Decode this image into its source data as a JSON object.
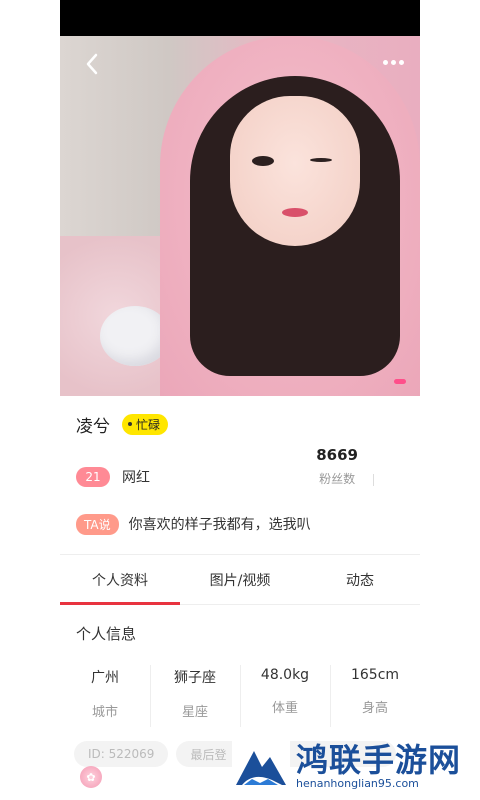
{
  "profile": {
    "name": "凌兮",
    "status": "忙碌",
    "age": "21",
    "role": "网红",
    "fans_count": "8669",
    "fans_label": "粉丝数",
    "bio_badge": "TA说",
    "bio": "你喜欢的样子我都有，选我叭"
  },
  "tabs": [
    {
      "label": "个人资料",
      "active": true
    },
    {
      "label": "图片/视频",
      "active": false
    },
    {
      "label": "动态",
      "active": false
    }
  ],
  "section": {
    "title": "个人信息"
  },
  "info": [
    {
      "value": "广州",
      "key": "城市"
    },
    {
      "value": "狮子座",
      "key": "星座"
    },
    {
      "value": "48.0kg",
      "key": "体重"
    },
    {
      "value": "165cm",
      "key": "身高"
    }
  ],
  "tags": {
    "id": "ID: 522069",
    "last_login": "最后登"
  },
  "watermark": {
    "title": "鸿联手游网",
    "url": "henanhonglian95.com"
  },
  "colors": {
    "accent": "#e8333f",
    "status_yellow": "#ffe600",
    "age_pink": "#ff8a95",
    "ta_badge": "#ff9a8a"
  }
}
